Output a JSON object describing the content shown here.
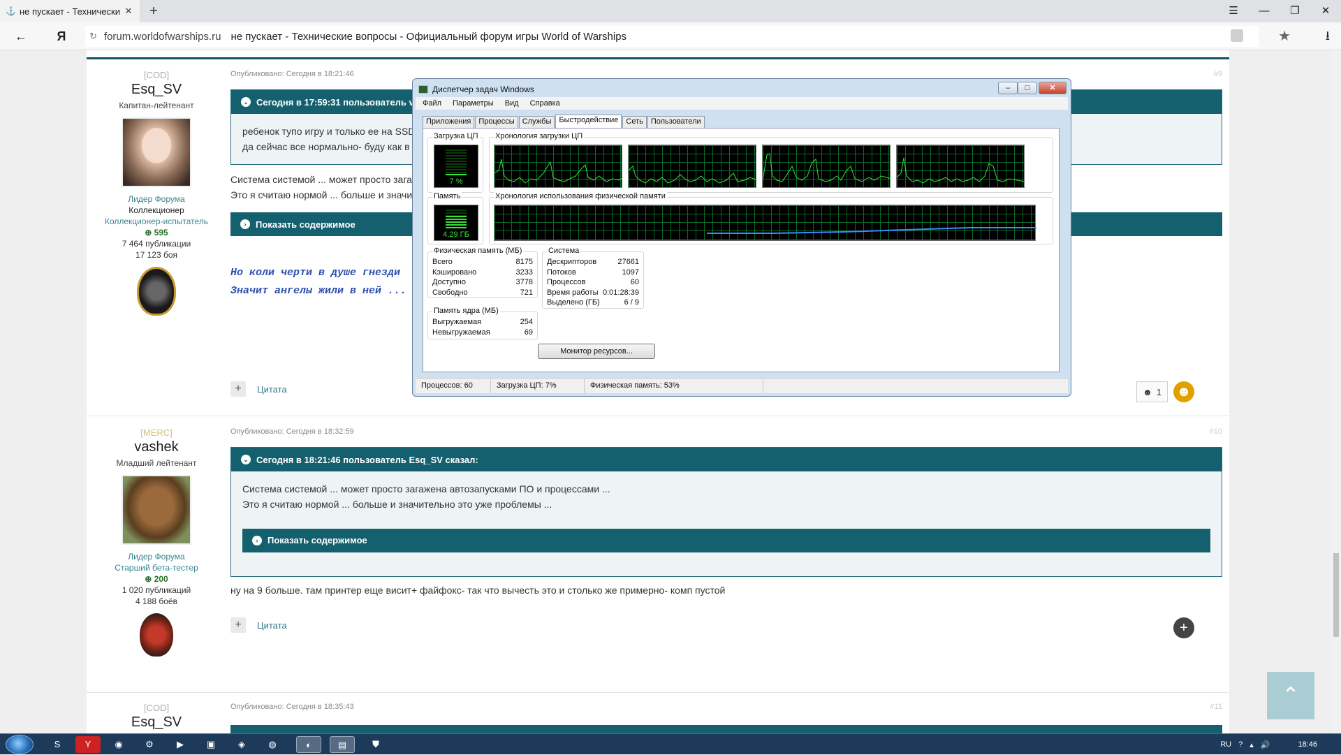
{
  "browser": {
    "tab_title": "не пускает - Технически",
    "domain": "forum.worldofwarships.ru",
    "page_title": "не пускает - Технические вопросы - Официальный форум игры World of Warships"
  },
  "posts": [
    {
      "clan": "[COD]",
      "nick": "Esq_SV",
      "rank": "Капитан-лейтенант",
      "role1": "Лидер Форума",
      "role2": "Коллекционер",
      "role3": "Коллекционер-испытатель",
      "rep": "595",
      "posts": "7 464 публикации",
      "battles": "17 123 боя",
      "published": "Опубликовано: Сегодня в 18:21:46",
      "num": "#9",
      "quote_header": "Сегодня в 17:59:31 пользователь va",
      "quote_line1": "ребенок тупо игру и только ее на SSD",
      "quote_line2": "да сейчас все нормально- буду как в",
      "text1": "Система системой ... может просто зага",
      "text2": "Это я считаю нормой ... больше и значи",
      "spoiler": "Показать содержимое",
      "sig1": "Но коли черти в душе гнезди",
      "sig2": "Значит ангелы жили в ней ...",
      "quote_btn": "Цитата",
      "reaction_count": "1"
    },
    {
      "clan": "[MERC]",
      "nick": "vashek",
      "rank": "Младший лейтенант",
      "role1": "Лидер Форума",
      "role2": "Старший бета-тестер",
      "rep": "200",
      "posts": "1 020 публикаций",
      "battles": "4 188 боёв",
      "published": "Опубликовано: Сегодня в 18:32:59",
      "num": "#10",
      "quote_header": "Сегодня в 18:21:46 пользователь Esq_SV сказал:",
      "quote_line1": "Система системой ... может просто загажена автозапусками ПО и процессами ...",
      "quote_line2": "Это я считаю нормой ... больше и значительно это уже проблемы ...",
      "spoiler": "Показать содержимое",
      "text": "ну на 9 больше. там принтер еще висит+ файфокс- так что вычесть это и столько же примерно- комп пустой",
      "quote_btn": "Цитата"
    },
    {
      "clan": "[COD]",
      "nick": "Esq_SV",
      "published": "Опубликовано: Сегодня в 18:35:43",
      "num": "#11"
    }
  ],
  "taskmgr": {
    "title": "Диспетчер задач Windows",
    "menu": [
      "Файл",
      "Параметры",
      "Вид",
      "Справка"
    ],
    "tabs": [
      "Приложения",
      "Процессы",
      "Службы",
      "Быстродействие",
      "Сеть",
      "Пользователи"
    ],
    "cpu_label": "Загрузка ЦП",
    "cpu_value": "7 %",
    "cpu_history_label": "Хронология загрузки ЦП",
    "mem_label": "Память",
    "mem_value": "4,29 ГБ",
    "mem_history_label": "Хронология использования физической памяти",
    "phys_label": "Физическая память (МБ)",
    "phys": [
      [
        "Всего",
        "8175"
      ],
      [
        "Кэшировано",
        "3233"
      ],
      [
        "Доступно",
        "3778"
      ],
      [
        "Свободно",
        "721"
      ]
    ],
    "kernel_label": "Память ядра (МБ)",
    "kernel": [
      [
        "Выгружаемая",
        "254"
      ],
      [
        "Невыгружаемая",
        "69"
      ]
    ],
    "sys_label": "Система",
    "sys": [
      [
        "Дескрипторов",
        "27661"
      ],
      [
        "Потоков",
        "1097"
      ],
      [
        "Процессов",
        "60"
      ],
      [
        "Время работы",
        "0:01:28:39"
      ],
      [
        "Выделено (ГБ)",
        "6 / 9"
      ]
    ],
    "monitor_btn": "Монитор ресурсов...",
    "status": [
      "Процессов: 60",
      "Загрузка ЦП: 7%",
      "Физическая память: 53%"
    ]
  },
  "taskbar": {
    "lang": "RU",
    "time": "18:46"
  }
}
